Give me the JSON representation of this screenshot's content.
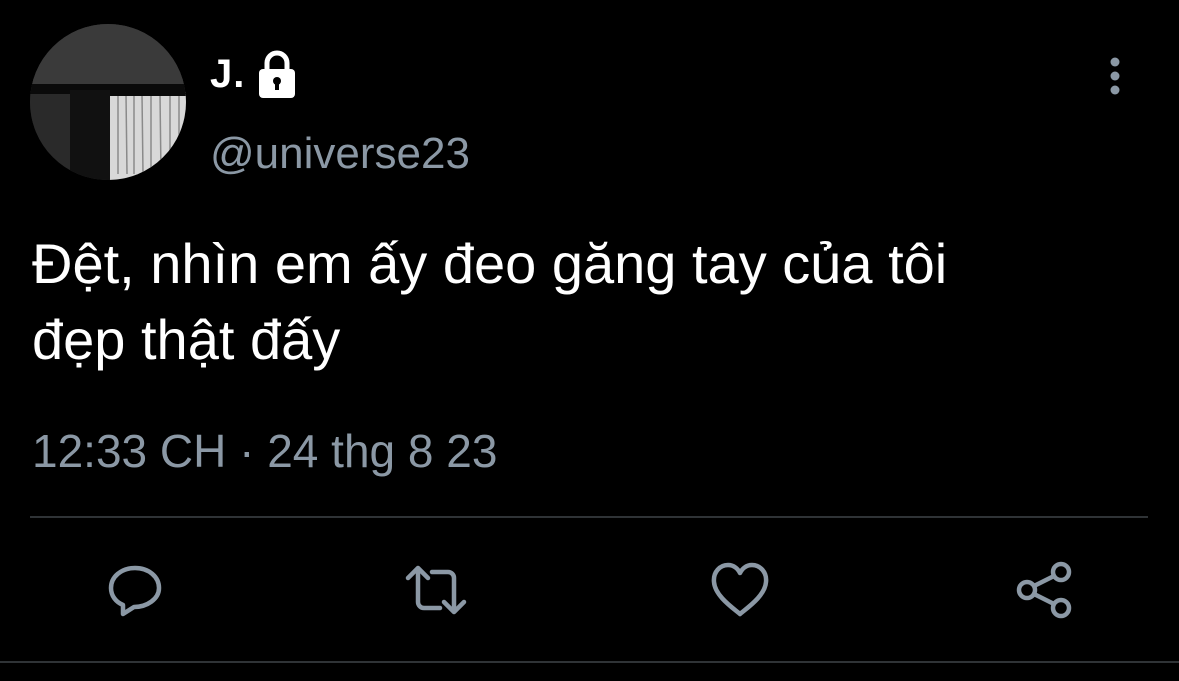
{
  "tweet": {
    "display_name": "J.",
    "handle": "@universe23",
    "text": "Đệt, nhìn em ấy đeo găng tay của tôi\nđẹp thật đấy",
    "timestamp": "12:33 CH · 24 thg 8 23",
    "protected_icon": "lock-icon",
    "avatar": "avatar-image"
  },
  "actions": [
    {
      "name": "reply",
      "icon": "reply-icon"
    },
    {
      "name": "retweet",
      "icon": "retweet-icon"
    },
    {
      "name": "like",
      "icon": "heart-icon"
    },
    {
      "name": "share",
      "icon": "share-icon"
    }
  ],
  "more_icon": "more-options-icon",
  "colors": {
    "background": "#000000",
    "primary_text": "#ffffff",
    "secondary_text": "#8b98a5",
    "divider": "#2f3336",
    "icon": "#8b98a5"
  }
}
